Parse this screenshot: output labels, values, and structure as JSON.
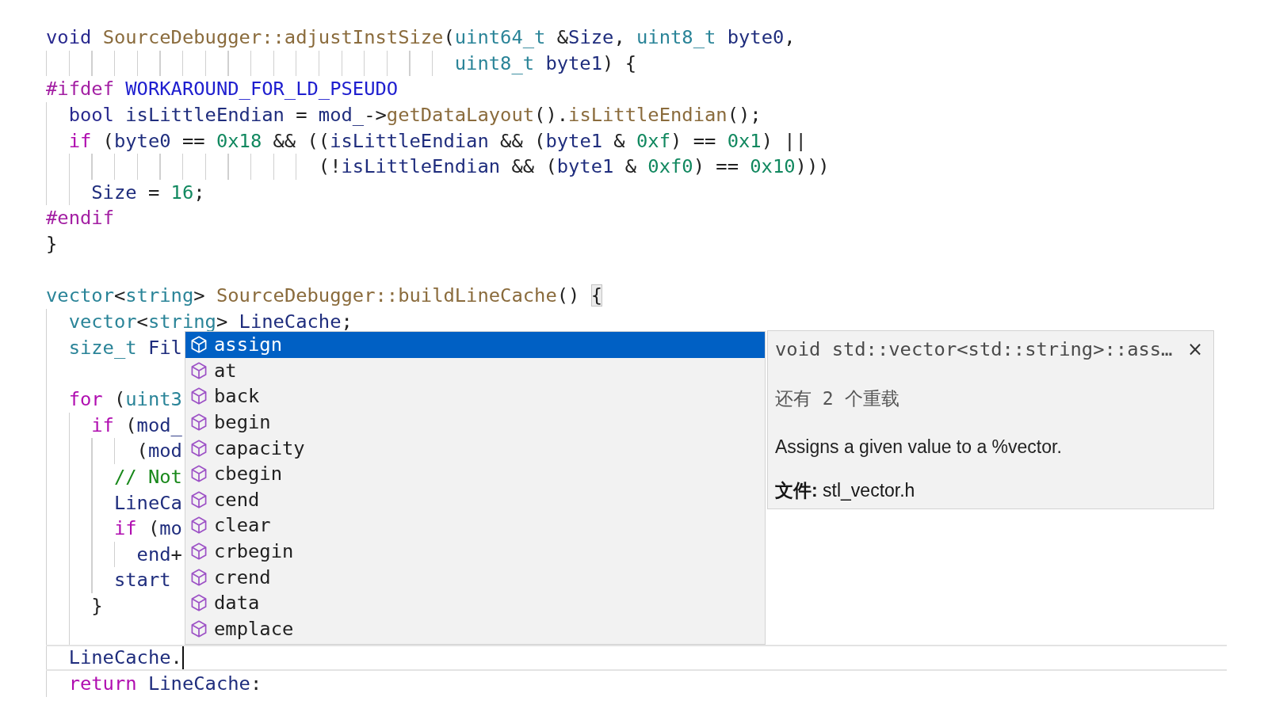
{
  "editor": {
    "lines": [
      {
        "current": false,
        "tokens": [
          {
            "kind": "kw",
            "text": "void "
          },
          {
            "kind": "fn",
            "text": "SourceDebugger::adjustInstSize"
          },
          {
            "kind": "op",
            "text": "("
          },
          {
            "kind": "type",
            "text": "uint64_t"
          },
          {
            "kind": "op",
            "text": " &"
          },
          {
            "kind": "var",
            "text": "Size"
          },
          {
            "kind": "op",
            "text": ", "
          },
          {
            "kind": "type",
            "text": "uint8_t "
          },
          {
            "kind": "var",
            "text": "byte0"
          },
          {
            "kind": "op",
            "text": ","
          }
        ]
      },
      {
        "current": false,
        "tokens": [
          {
            "kind": "type",
            "text": "                                    uint8_t "
          },
          {
            "kind": "var",
            "text": "byte1"
          },
          {
            "kind": "op",
            "text": ") {"
          }
        ]
      },
      {
        "current": false,
        "tokens": [
          {
            "kind": "pp",
            "text": "#ifdef "
          },
          {
            "kind": "macro",
            "text": "WORKAROUND_FOR_LD_PSEUDO"
          }
        ]
      },
      {
        "current": false,
        "tokens": [
          {
            "kind": "kw",
            "text": "  bool "
          },
          {
            "kind": "var",
            "text": "isLittleEndian"
          },
          {
            "kind": "op",
            "text": " = "
          },
          {
            "kind": "var",
            "text": "mod_"
          },
          {
            "kind": "op",
            "text": "->"
          },
          {
            "kind": "fn",
            "text": "getDataLayout"
          },
          {
            "kind": "op",
            "text": "()."
          },
          {
            "kind": "fn",
            "text": "isLittleEndian"
          },
          {
            "kind": "op",
            "text": "();"
          }
        ]
      },
      {
        "current": false,
        "tokens": [
          {
            "kind": "ctl",
            "text": "  if"
          },
          {
            "kind": "op",
            "text": " ("
          },
          {
            "kind": "var",
            "text": "byte0"
          },
          {
            "kind": "op",
            "text": " == "
          },
          {
            "kind": "num",
            "text": "0x18"
          },
          {
            "kind": "op",
            "text": " && (("
          },
          {
            "kind": "var",
            "text": "isLittleEndian"
          },
          {
            "kind": "op",
            "text": " && ("
          },
          {
            "kind": "var",
            "text": "byte1"
          },
          {
            "kind": "op",
            "text": " & "
          },
          {
            "kind": "num",
            "text": "0xf"
          },
          {
            "kind": "op",
            "text": ") == "
          },
          {
            "kind": "num",
            "text": "0x1"
          },
          {
            "kind": "op",
            "text": ") ||"
          }
        ]
      },
      {
        "current": false,
        "tokens": [
          {
            "kind": "op",
            "text": "                        (!"
          },
          {
            "kind": "var",
            "text": "isLittleEndian"
          },
          {
            "kind": "op",
            "text": " && ("
          },
          {
            "kind": "var",
            "text": "byte1"
          },
          {
            "kind": "op",
            "text": " & "
          },
          {
            "kind": "num",
            "text": "0xf0"
          },
          {
            "kind": "op",
            "text": ") == "
          },
          {
            "kind": "num",
            "text": "0x10"
          },
          {
            "kind": "op",
            "text": ")))"
          }
        ]
      },
      {
        "current": false,
        "tokens": [
          {
            "kind": "var",
            "text": "    Size"
          },
          {
            "kind": "op",
            "text": " = "
          },
          {
            "kind": "num",
            "text": "16"
          },
          {
            "kind": "op",
            "text": ";"
          }
        ]
      },
      {
        "current": false,
        "tokens": [
          {
            "kind": "pp",
            "text": "#endif"
          }
        ]
      },
      {
        "current": false,
        "tokens": [
          {
            "kind": "op",
            "text": "}"
          }
        ]
      },
      {
        "current": false
      },
      {
        "current": false,
        "tokens": [
          {
            "kind": "type",
            "text": "vector"
          },
          {
            "kind": "op",
            "text": "<"
          },
          {
            "kind": "type",
            "text": "string"
          },
          {
            "kind": "op",
            "text": "> "
          },
          {
            "kind": "fn",
            "text": "SourceDebugger::buildLineCache"
          },
          {
            "kind": "op",
            "text": "() "
          },
          {
            "kind": "match",
            "text": "{"
          }
        ]
      },
      {
        "current": false,
        "tokens": [
          {
            "kind": "type",
            "text": "  vector"
          },
          {
            "kind": "op",
            "text": "<"
          },
          {
            "kind": "type",
            "text": "string"
          },
          {
            "kind": "op",
            "text": "> "
          },
          {
            "kind": "var",
            "text": "LineCache"
          },
          {
            "kind": "op",
            "text": ";"
          }
        ]
      },
      {
        "current": false,
        "tokens": [
          {
            "kind": "type",
            "text": "  size_t "
          },
          {
            "kind": "var",
            "text": "Fil"
          }
        ]
      },
      {
        "current": false
      },
      {
        "current": false,
        "tokens": [
          {
            "kind": "ctl",
            "text": "  for"
          },
          {
            "kind": "op",
            "text": " ("
          },
          {
            "kind": "type",
            "text": "uint3"
          }
        ]
      },
      {
        "current": false,
        "tokens": [
          {
            "kind": "ctl",
            "text": "    if"
          },
          {
            "kind": "op",
            "text": " ("
          },
          {
            "kind": "var",
            "text": "mod_"
          }
        ]
      },
      {
        "current": false,
        "tokens": [
          {
            "kind": "op",
            "text": "        ("
          },
          {
            "kind": "var",
            "text": "mod"
          }
        ]
      },
      {
        "current": false,
        "tokens": [
          {
            "kind": "cm",
            "text": "      // Not"
          }
        ]
      },
      {
        "current": false,
        "tokens": [
          {
            "kind": "var",
            "text": "      LineCa"
          }
        ]
      },
      {
        "current": false,
        "tokens": [
          {
            "kind": "ctl",
            "text": "      if"
          },
          {
            "kind": "op",
            "text": " ("
          },
          {
            "kind": "var",
            "text": "mo"
          }
        ]
      },
      {
        "current": false,
        "tokens": [
          {
            "kind": "var",
            "text": "        end"
          },
          {
            "kind": "op",
            "text": "+"
          }
        ]
      },
      {
        "current": false,
        "tokens": [
          {
            "kind": "var",
            "text": "      start"
          }
        ]
      },
      {
        "current": false,
        "tokens": [
          {
            "kind": "op",
            "text": "    }"
          }
        ]
      },
      {
        "current": false
      },
      {
        "current": true,
        "tokens": [
          {
            "kind": "var",
            "text": "  LineCache"
          },
          {
            "kind": "op",
            "text": "."
          }
        ]
      },
      {
        "current": false,
        "tokens": [
          {
            "kind": "ctl",
            "text": "  return "
          },
          {
            "kind": "var",
            "text": "LineCache"
          },
          {
            "kind": "op",
            "text": ":"
          }
        ]
      }
    ]
  },
  "completion": {
    "items": [
      {
        "label": "assign",
        "selected": true
      },
      {
        "label": "at",
        "selected": false
      },
      {
        "label": "back",
        "selected": false
      },
      {
        "label": "begin",
        "selected": false
      },
      {
        "label": "capacity",
        "selected": false
      },
      {
        "label": "cbegin",
        "selected": false
      },
      {
        "label": "cend",
        "selected": false
      },
      {
        "label": "clear",
        "selected": false
      },
      {
        "label": "crbegin",
        "selected": false
      },
      {
        "label": "crend",
        "selected": false
      },
      {
        "label": "data",
        "selected": false
      },
      {
        "label": "emplace",
        "selected": false
      }
    ]
  },
  "doc_tooltip": {
    "signature": "void std::vector<std::string>::ass…",
    "close": "×",
    "overloads": "还有 2 个重载",
    "description": "Assigns a given value to a %vector.",
    "file": "**文件:** stl_vector.h"
  }
}
